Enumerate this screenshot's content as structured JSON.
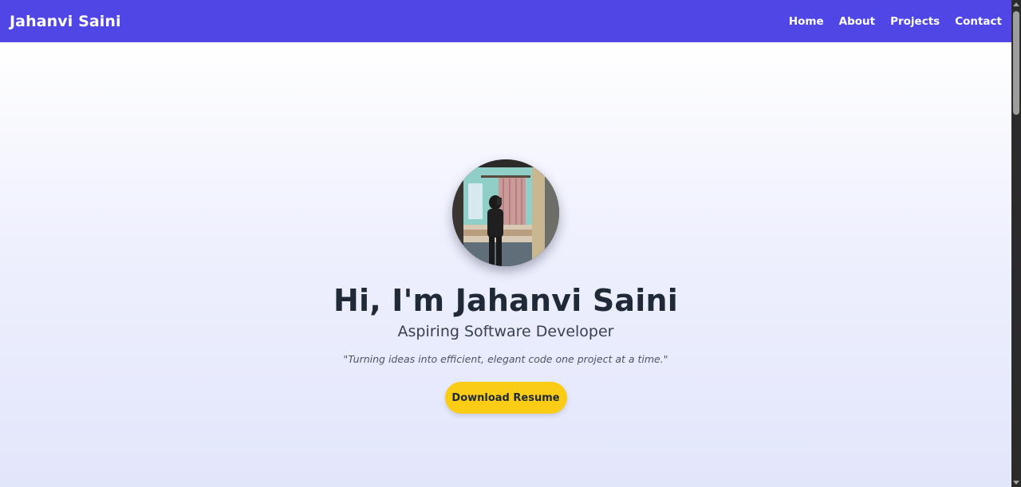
{
  "navbar": {
    "brand": "Jahanvi Saini",
    "links": [
      {
        "label": "Home"
      },
      {
        "label": "About"
      },
      {
        "label": "Projects"
      },
      {
        "label": "Contact"
      }
    ],
    "background": "#4f46e5"
  },
  "hero": {
    "title": "Hi, I'm Jahanvi Saini",
    "subtitle": "Aspiring Software Developer",
    "quote": "\"Turning ideas into efficient, elegant code one project at a time.\"",
    "button_label": "Download Resume",
    "button_color": "#facc15",
    "avatar": "profile-photo"
  }
}
